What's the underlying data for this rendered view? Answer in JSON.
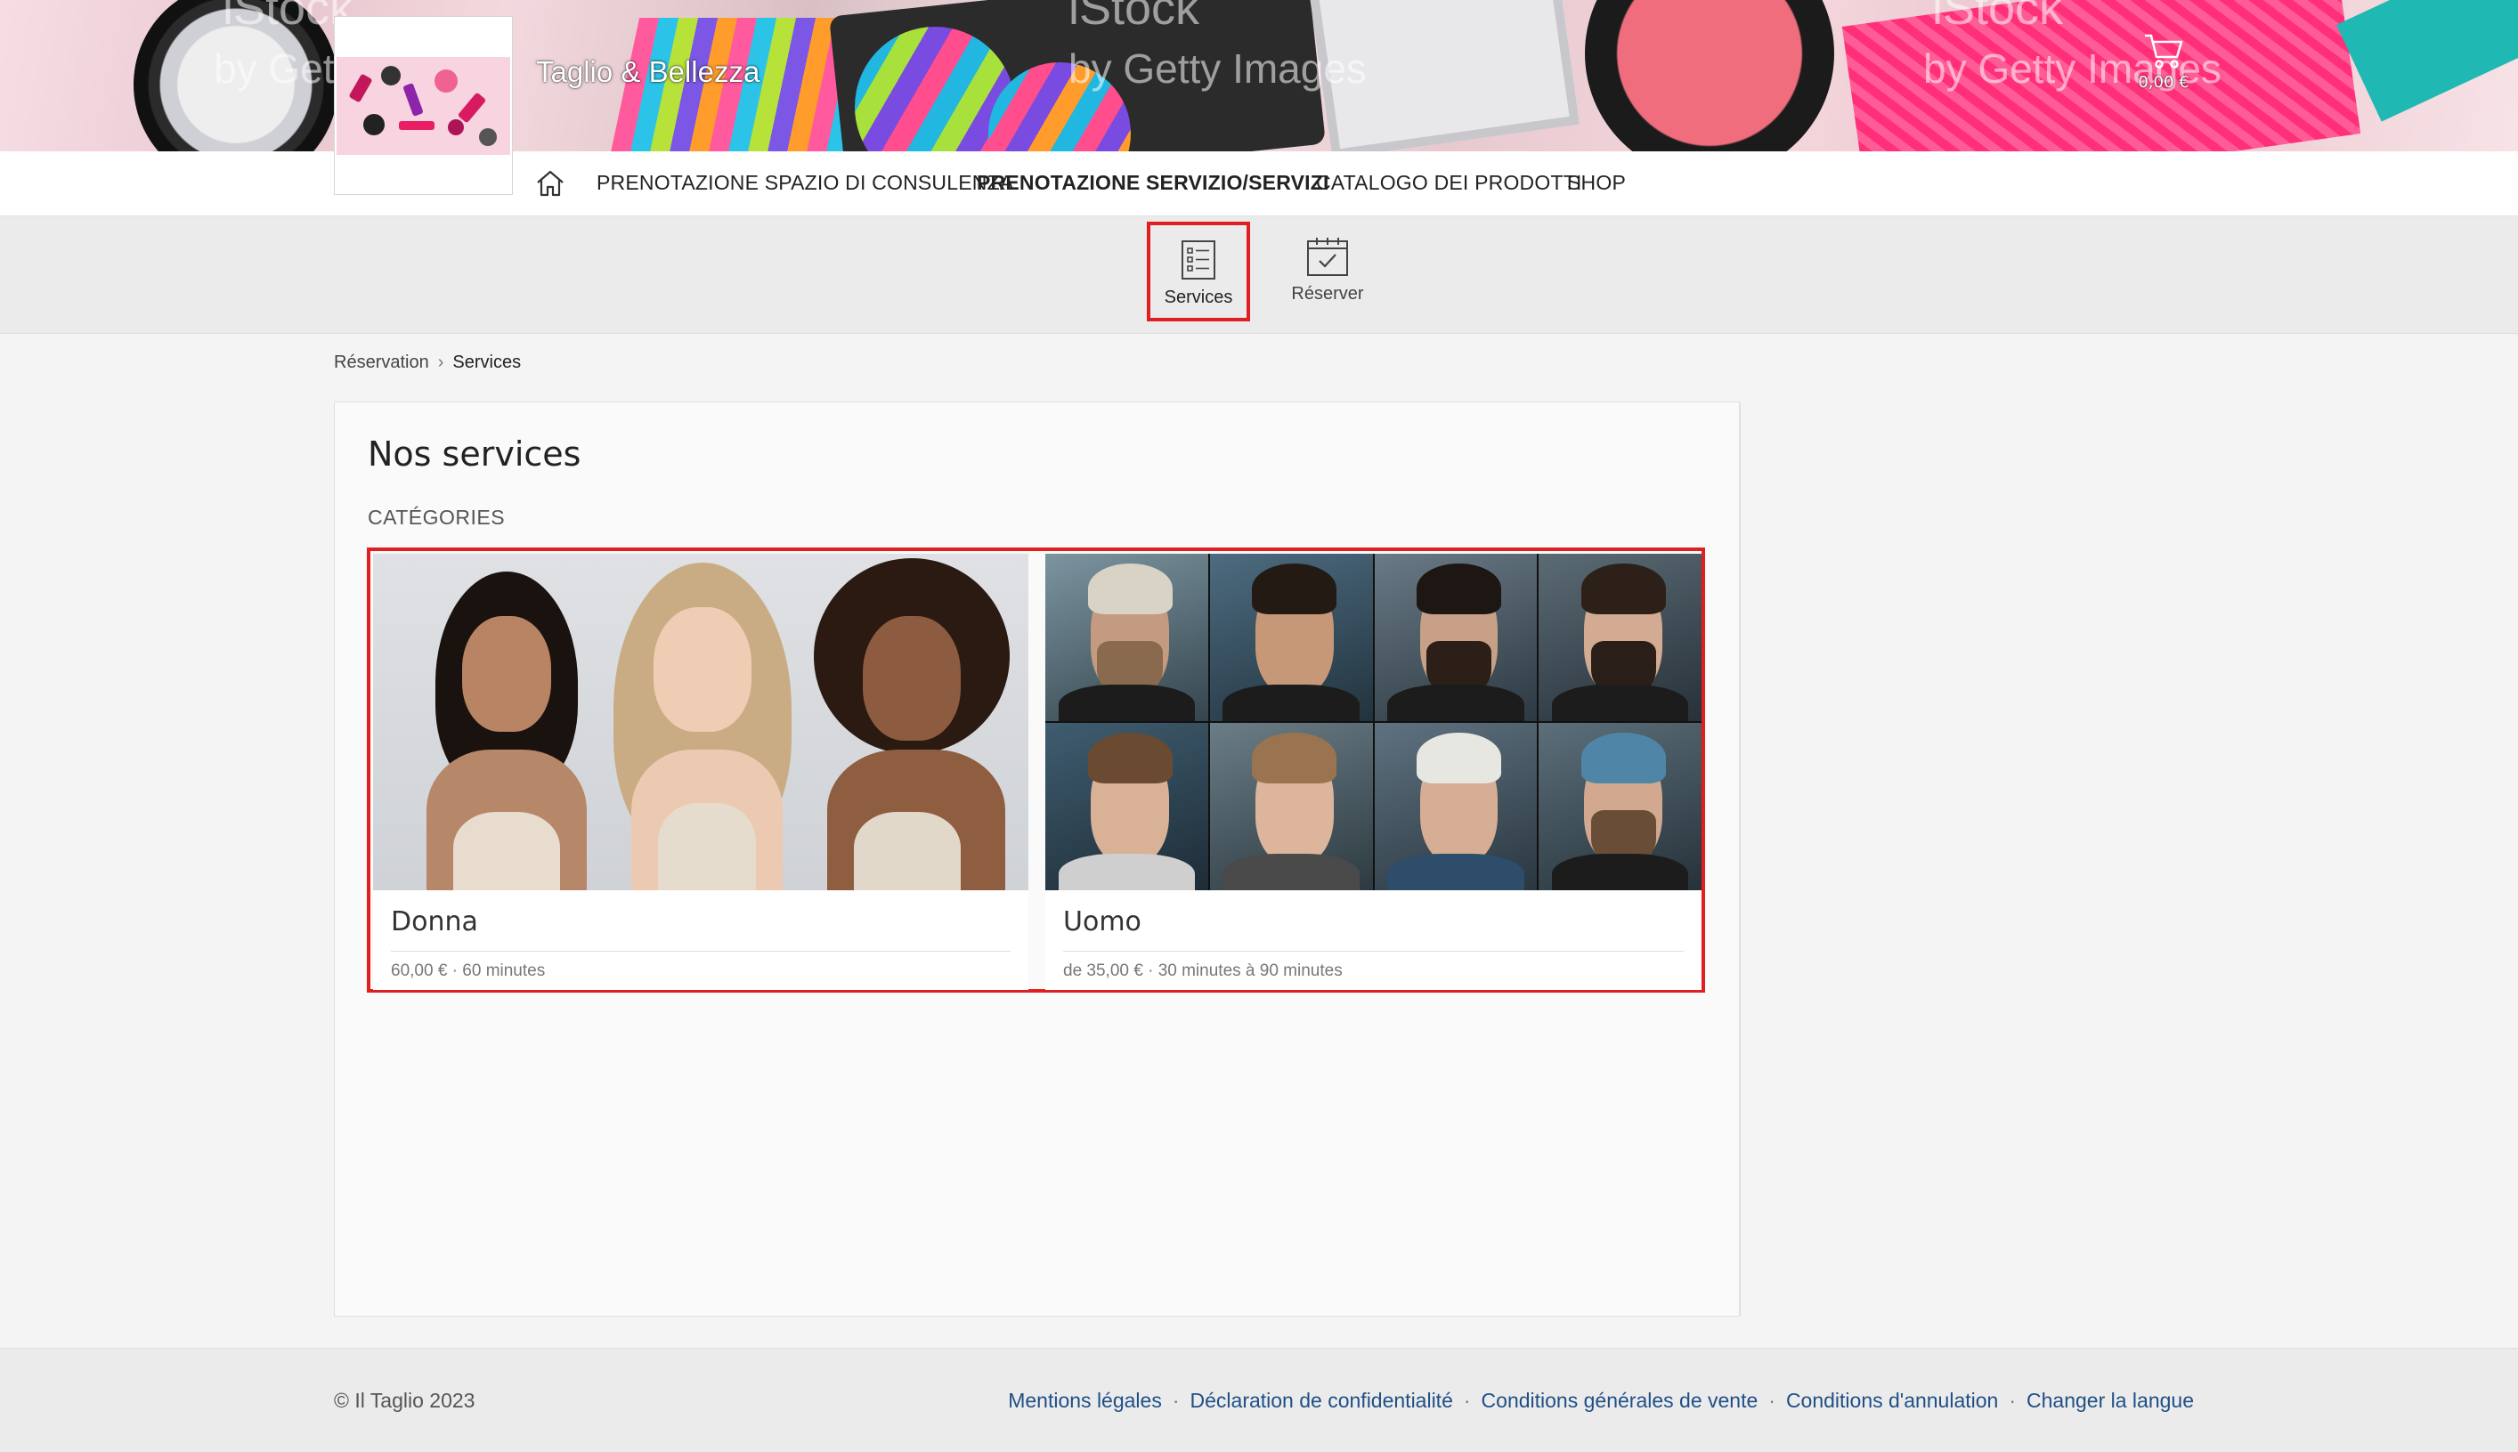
{
  "header": {
    "brand": "Taglio & Bellezza",
    "cart_amount": "0,00 €",
    "watermarks": [
      "iStock",
      "by Getty Images",
      "iStock",
      "by Getty Images",
      "iStock",
      "by Getty Images"
    ]
  },
  "nav": {
    "items": [
      {
        "label": "PRENOTAZIONE SPAZIO DI CONSULENZA",
        "active": false
      },
      {
        "label": "PRENOTAZIONE SERVIZIO/SERVIZI",
        "active": true
      },
      {
        "label": "CATALOGO DEI PRODOTTI",
        "active": false
      },
      {
        "label": "SHOP",
        "active": false
      }
    ]
  },
  "subnav": {
    "services_label": "Services",
    "book_label": "Réserver"
  },
  "breadcrumb": {
    "root": "Réservation",
    "separator": "›",
    "current": "Services"
  },
  "main": {
    "title": "Nos services",
    "categories_heading": "CATÉGORIES",
    "categories": [
      {
        "name": "Donna",
        "meta": "60,00 € · 60 minutes"
      },
      {
        "name": "Uomo",
        "meta": "de 35,00 € · 30 minutes à 90 minutes"
      }
    ]
  },
  "footer": {
    "copyright": "© Il Taglio 2023",
    "links": [
      "Mentions légales",
      "Déclaration de confidentialité",
      "Conditions générales de vente",
      "Conditions d'annulation",
      "Changer la langue"
    ],
    "separator": "·"
  },
  "colors": {
    "highlight": "#e02020",
    "link": "#1f4f86"
  }
}
